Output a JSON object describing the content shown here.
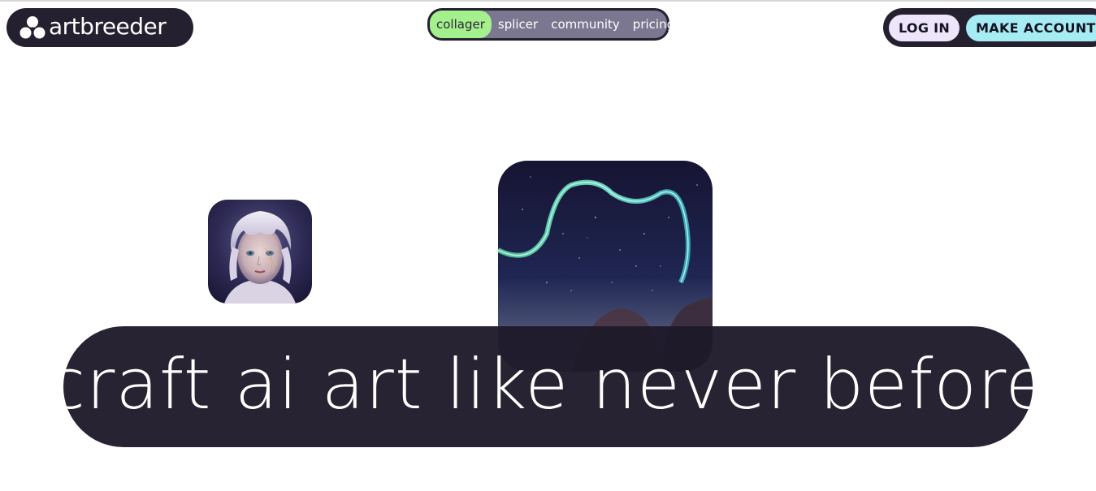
{
  "brand": {
    "name": "artbreeder",
    "logo_icon": "artbreeder-trefoil-icon"
  },
  "nav": {
    "items": [
      {
        "label": "collager",
        "active": true
      },
      {
        "label": "splicer",
        "active": false
      },
      {
        "label": "community",
        "active": false
      },
      {
        "label": "pricing",
        "active": false
      }
    ]
  },
  "auth": {
    "login_label": "LOG IN",
    "signup_label": "MAKE ACCOUNT"
  },
  "hero": {
    "headline": "craft ai art like never before"
  },
  "colors": {
    "dark": "#24202f",
    "nav_active": "#a3f08c",
    "login_bg": "#ede6fb",
    "signup_bg": "#a6ecf4"
  }
}
